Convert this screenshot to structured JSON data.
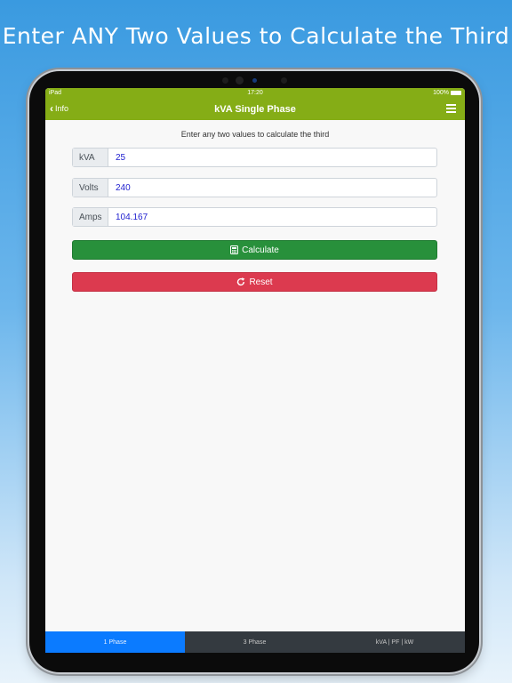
{
  "headline": "Enter ANY Two Values to Calculate the Third",
  "status_bar": {
    "carrier": "iPad",
    "time": "17:20",
    "battery": "100%"
  },
  "nav": {
    "back_label": "Info",
    "title": "kVA Single Phase"
  },
  "instruction": "Enter any two values to calculate the third",
  "fields": [
    {
      "label": "kVA",
      "value": "25"
    },
    {
      "label": "Volts",
      "value": "240"
    },
    {
      "label": "Amps",
      "value": "104.167"
    }
  ],
  "buttons": {
    "calculate": "Calculate",
    "reset": "Reset"
  },
  "tabs": [
    {
      "label": "1 Phase",
      "active": true
    },
    {
      "label": "3 Phase",
      "active": false
    },
    {
      "label": "kVA | PF | kW",
      "active": false
    }
  ],
  "colors": {
    "navbar": "#85ad16",
    "calculate": "#28903b",
    "reset": "#dc3a4f",
    "active_tab": "#0b7bff",
    "tabbar": "#343a40"
  },
  "icons": {
    "calculate": "calculator-icon",
    "reset": "redo-icon",
    "back": "chevron-left-icon",
    "menu": "hamburger-menu-icon"
  }
}
